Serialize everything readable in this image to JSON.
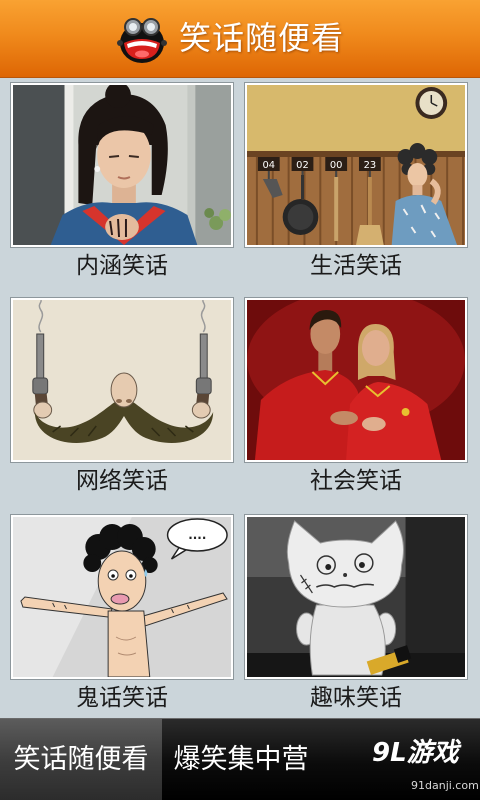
{
  "header": {
    "title": "笑话随便看",
    "logo_icon": "app-logo-icon"
  },
  "categories": [
    {
      "label": "内涵笑话"
    },
    {
      "label": "生活笑话",
      "image_text": [
        "04",
        "02",
        "00",
        "23"
      ]
    },
    {
      "label": "网络笑话"
    },
    {
      "label": "社会笑话"
    },
    {
      "label": "鬼话笑话",
      "image_text": [
        "...."
      ]
    },
    {
      "label": "趣味笑话"
    }
  ],
  "tabbar": {
    "tabs": [
      {
        "label": "笑话随便看",
        "selected": true
      },
      {
        "label": "爆笑集中营",
        "selected": false
      }
    ]
  },
  "watermark": {
    "logo": "9L游戏",
    "site": "91danji.com"
  },
  "colors": {
    "header_top": "#f9a232",
    "header_bottom": "#de6604",
    "background": "#cbd5da",
    "label_text": "#1b1b1b",
    "tabbar": "#0b0b0b",
    "tab_selected": "#3e3e3e"
  }
}
